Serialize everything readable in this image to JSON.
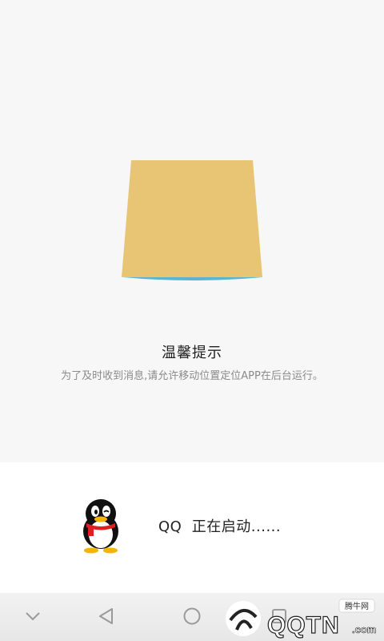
{
  "hint": {
    "title": "温馨提示",
    "description": "为了及时收到消息,请允许移动位置定位APP在后台运行。"
  },
  "launch": {
    "text": "QQ  正在启动......"
  },
  "nav": {
    "icons": [
      "chevron-down-icon",
      "back-triangle-icon",
      "home-circle-icon",
      "recent-square-icon"
    ]
  },
  "watermark": {
    "brand": "QQTN.com",
    "tag": "腾牛网"
  },
  "colors": {
    "box": "#e8c574",
    "box_edge": "#5bb5d0",
    "penguin_scarf": "#e02020",
    "penguin_feet": "#f4b400"
  }
}
